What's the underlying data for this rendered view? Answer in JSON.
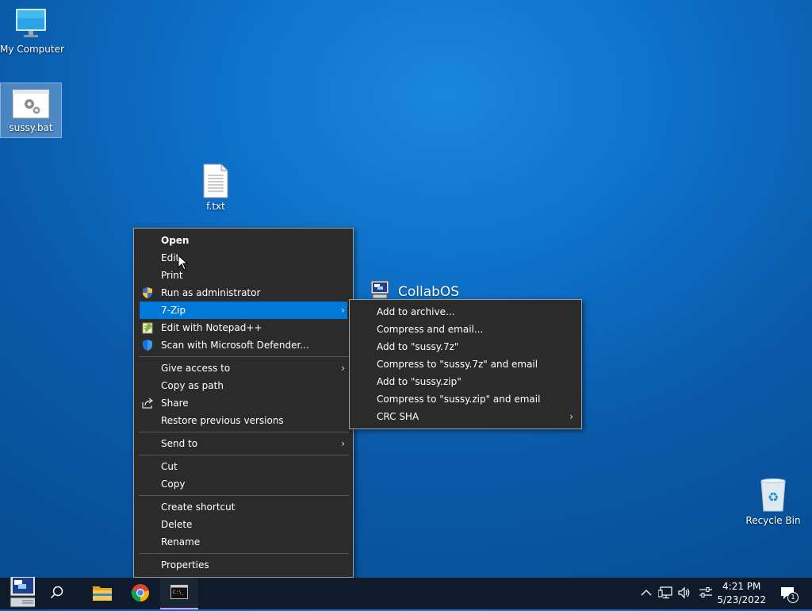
{
  "desktop": {
    "icons": [
      {
        "label": "My Computer",
        "icon": "monitor-icon"
      },
      {
        "label": "sussy.bat",
        "icon": "batch-file-gear-icon"
      },
      {
        "label": "f.txt",
        "icon": "text-file-icon"
      },
      {
        "label": "Recycle Bin",
        "icon": "recycle-bin-icon"
      }
    ],
    "watermark": "CollabOS"
  },
  "context_menu": {
    "items": [
      {
        "label": "Open"
      },
      {
        "label": "Edit"
      },
      {
        "label": "Print"
      },
      {
        "label": "Run as administrator",
        "icon": "uac-shield-icon"
      },
      {
        "label": "7-Zip",
        "arrow": "›"
      },
      {
        "label": "Edit with Notepad++",
        "icon": "notepadpp-icon"
      },
      {
        "label": "Scan with Microsoft Defender...",
        "icon": "defender-shield-icon"
      },
      {
        "label": "Give access to",
        "arrow": "›"
      },
      {
        "label": "Copy as path"
      },
      {
        "label": "Share",
        "icon": "share-icon"
      },
      {
        "label": "Restore previous versions"
      },
      {
        "label": "Send to",
        "arrow": "›"
      },
      {
        "label": "Cut"
      },
      {
        "label": "Copy"
      },
      {
        "label": "Create shortcut"
      },
      {
        "label": "Delete"
      },
      {
        "label": "Rename"
      },
      {
        "label": "Properties"
      }
    ]
  },
  "submenu_7zip": {
    "items": [
      {
        "label": "Add to archive..."
      },
      {
        "label": "Compress and email..."
      },
      {
        "label": "Add to \"sussy.7z\""
      },
      {
        "label": "Compress to \"sussy.7z\" and email"
      },
      {
        "label": "Add to \"sussy.zip\""
      },
      {
        "label": "Compress to \"sussy.zip\" and email"
      },
      {
        "label": "CRC SHA",
        "arrow": "›"
      }
    ]
  },
  "taskbar": {
    "apps": [
      "start-icon",
      "search-icon",
      "file-explorer-icon",
      "chrome-icon",
      "terminal-icon"
    ],
    "tray": {
      "chevron": "^",
      "notification_count": "1"
    },
    "clock": {
      "time": "4:21 PM",
      "date": "5/23/2022"
    }
  },
  "colors": {
    "highlight": "#0078d7",
    "menu_bg": "#2b2b2b",
    "taskbar_bg": "#0f1b2b"
  }
}
